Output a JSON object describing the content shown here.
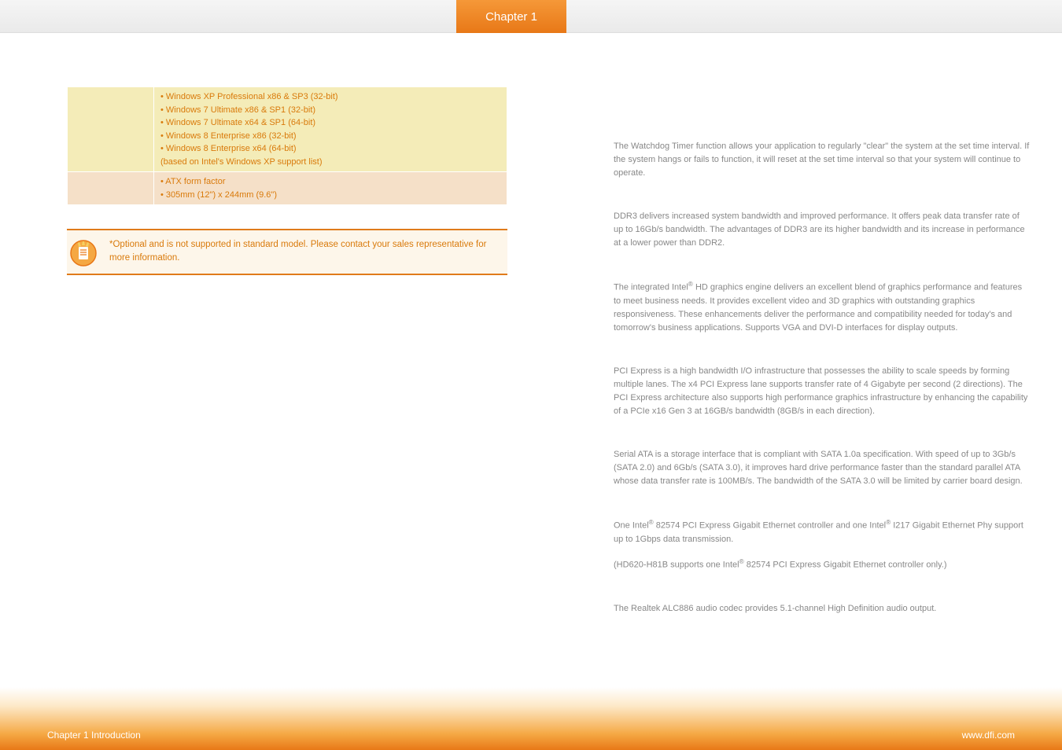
{
  "header": {
    "chapter_label": "Chapter 1"
  },
  "spec_table": {
    "row1": {
      "label": "",
      "v1": "• Windows XP Professional x86 & SP3 (32-bit)",
      "v2": "• Windows 7 Ultimate x86 & SP1 (32-bit)",
      "v3": "• Windows 7 Ultimate x64 & SP1 (64-bit)",
      "v4": "• Windows 8 Enterprise x86 (32-bit)",
      "v5": "• Windows 8 Enterprise x64 (64-bit)",
      "v6": "  (based on Intel's Windows XP support list)"
    },
    "row2": {
      "label": "",
      "v1": "• ATX form factor",
      "v2": "• 305mm (12\") x 244mm (9.6\")"
    }
  },
  "note": {
    "text": "*Optional and is not supported in standard model. Please contact your sales representative for more information."
  },
  "features": {
    "watchdog": "The Watchdog Timer function allows your application to regularly \"clear\" the system at the set time interval. If the system hangs or fails to function, it will reset at the set time interval so that your system will continue to operate.",
    "ddr3": "DDR3 delivers increased system bandwidth and improved performance. It offers peak data transfer rate of up to 16Gb/s bandwidth. The advantages of DDR3 are its higher bandwidth and its increase in performance at a lower power than DDR2.",
    "graphics_a": "The integrated Intel",
    "graphics_b": " HD graphics engine delivers an excellent blend of graphics performance and features to meet business needs. It provides  excellent video and 3D graphics with outstanding graphics responsiveness. These enhancements deliver the performance and compatibility needed for today's and tomorrow's business applications. Supports VGA and DVI-D interfaces for display outputs.",
    "pcie": "PCI Express is a high bandwidth I/O infrastructure that possesses the ability to scale speeds by forming multiple lanes. The x4 PCI Express lane supports transfer rate of 4 Gigabyte per second (2 directions). The PCI Express architecture also supports high performance graphics infrastructure by enhancing the capability of a PCIe x16 Gen 3 at 16GB/s bandwidth (8GB/s in each direction).",
    "sata": "Serial ATA is a storage interface that is compliant with SATA 1.0a specification. With speed of up to 3Gb/s (SATA 2.0) and 6Gb/s (SATA 3.0), it improves hard drive performance faster than the standard parallel ATA whose data transfer rate is 100MB/s. The bandwidth of the SATA 3.0 will be limited by carrier board design.",
    "lan_a": "One Intel",
    "lan_b": " 82574 PCI Express Gigabit Ethernet controller and one Intel",
    "lan_c": " I217 Gigabit Ethernet Phy support up to 1Gbps data transmission.",
    "lan_note_a": "(HD620-H81B supports one Intel",
    "lan_note_b": " 82574 PCI Express Gigabit Ethernet controller only.)",
    "audio": "The Realtek ALC886 audio codec provides 5.1-channel High Definition audio output."
  },
  "footer": {
    "left": "Chapter 1 Introduction",
    "right": "www.dfi.com"
  }
}
